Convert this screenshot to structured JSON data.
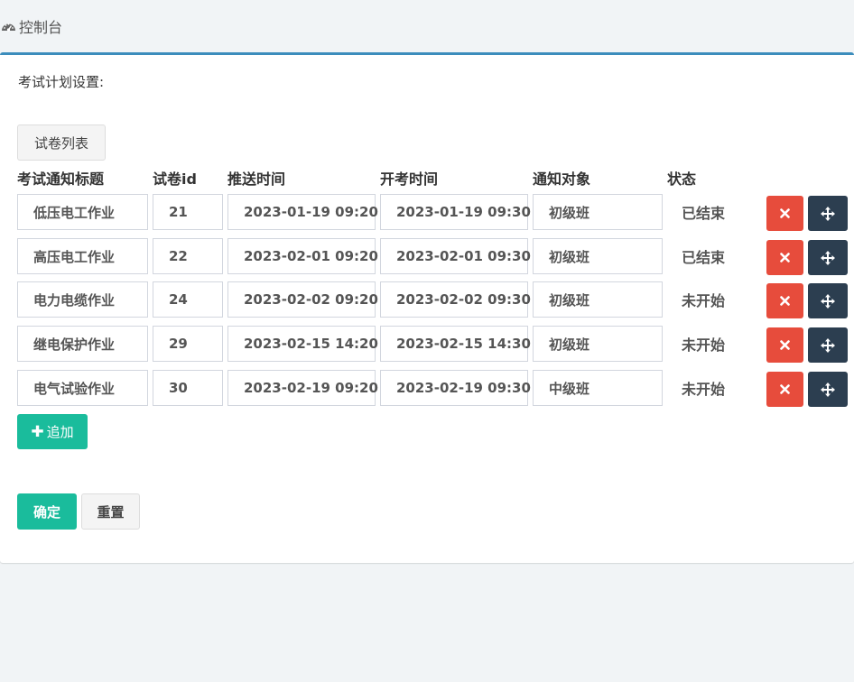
{
  "header": {
    "icon": "dashboard-icon",
    "title": "控制台"
  },
  "form": {
    "section_label": "考试计划设置:",
    "paper_list_button": "试卷列表",
    "columns": [
      "考试通知标题",
      "试卷id",
      "推送时间",
      "开考时间",
      "通知对象",
      "状态"
    ],
    "rows": [
      {
        "title": "低压电工作业",
        "paper_id": "21",
        "push_time": "2023-01-19 09:20",
        "exam_time": "2023-01-19 09:30",
        "target": "初级班",
        "status": "已结束"
      },
      {
        "title": "高压电工作业",
        "paper_id": "22",
        "push_time": "2023-02-01 09:20",
        "exam_time": "2023-02-01 09:30",
        "target": "初级班",
        "status": "已结束"
      },
      {
        "title": "电力电缆作业",
        "paper_id": "24",
        "push_time": "2023-02-02 09:20",
        "exam_time": "2023-02-02 09:30",
        "target": "初级班",
        "status": "未开始"
      },
      {
        "title": "继电保护作业",
        "paper_id": "29",
        "push_time": "2023-02-15 14:20",
        "exam_time": "2023-02-15 14:30",
        "target": "初级班",
        "status": "未开始"
      },
      {
        "title": "电气试验作业",
        "paper_id": "30",
        "push_time": "2023-02-19 09:20",
        "exam_time": "2023-02-19 09:30",
        "target": "中级班",
        "status": "未开始"
      }
    ],
    "row_icons": {
      "delete": "close-icon",
      "move": "move-arrows-icon"
    },
    "add_button": "追加",
    "confirm_button": "确定",
    "reset_button": "重置"
  },
  "colors": {
    "panel_top_border": "#3c8dbc",
    "primary": "#1abc9c",
    "danger": "#e74c3c",
    "dark": "#2c3e50",
    "background": "#f1f4f6"
  }
}
